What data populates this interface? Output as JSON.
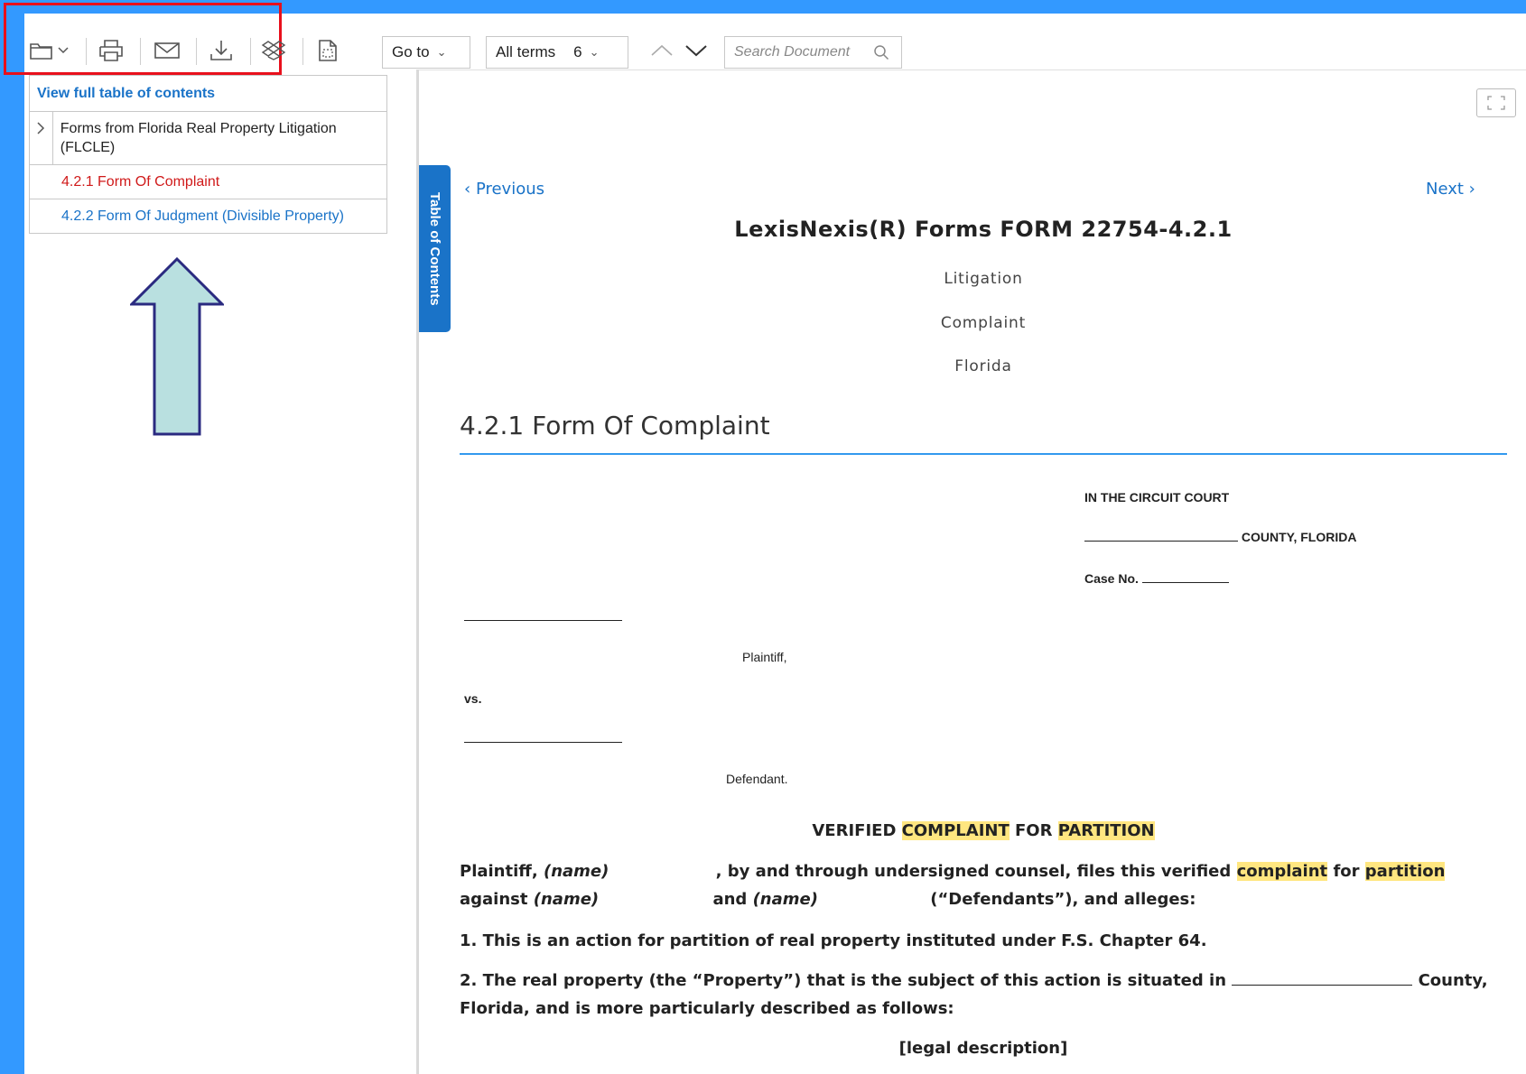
{
  "toolbar": {
    "icons": [
      "folder-icon",
      "chevron-down-icon",
      "print-icon",
      "email-icon",
      "download-icon",
      "dropbox-icon",
      "document-icon"
    ],
    "goto_label": "Go to",
    "terms_label": "All terms",
    "terms_count": "6",
    "search_placeholder": "Search Document"
  },
  "toc": {
    "header": "View full table of contents",
    "parent_label": "Forms from Florida Real Property Litigation (FLCLE)",
    "current_item": "4.2.1 Form Of Complaint",
    "next_item": "4.2.2 Form Of Judgment (Divisible Property)",
    "tab_label": "Table of Contents"
  },
  "colors": {
    "background": "#3399ff",
    "link": "#1a73c8",
    "current": "#d01a1a",
    "highlight": "#ffe680",
    "annotation_box": "#e8101c",
    "arrow_fill": "#b9e0e0",
    "arrow_stroke": "#2a2a80"
  },
  "document": {
    "prev_label": "Previous",
    "next_label": "Next",
    "title": "LexisNexis(R) Forms FORM 22754-4.2.1",
    "meta": [
      "Litigation",
      "Complaint",
      "Florida"
    ],
    "section_title": "4.2.1 Form Of Complaint",
    "court_line1": "IN THE CIRCUIT COURT",
    "court_line2": "COUNTY, FLORIDA",
    "case_no": "Case No.",
    "plaintiff_label": "Plaintiff,",
    "vs_label": "vs.",
    "defendant_label": "Defendant.",
    "heading_verified": "VERIFIED",
    "heading_complaint": "COMPLAINT",
    "heading_for": "FOR",
    "heading_partition": "PARTITION",
    "p1_a": "Plaintiff,",
    "p1_name1": "(name)",
    "p1_b": ", by and through undersigned counsel, files this verified",
    "p1_complaint": "complaint",
    "p1_for": "for",
    "p1_partition": "partition",
    "p1_c": "against",
    "p1_name2": "(name)",
    "p1_and": "and",
    "p1_name3": "(name)",
    "p1_d": "(“Defendants”), and alleges:",
    "p2": "1. This is an action for partition of real property instituted under F.S. Chapter 64.",
    "p3_a": "2. The real property (the “Property”) that is the subject of this action is situated in",
    "p3_b": "County,",
    "p3_c": "Florida, and is more particularly described as follows:",
    "legal_description": "[legal description]"
  }
}
